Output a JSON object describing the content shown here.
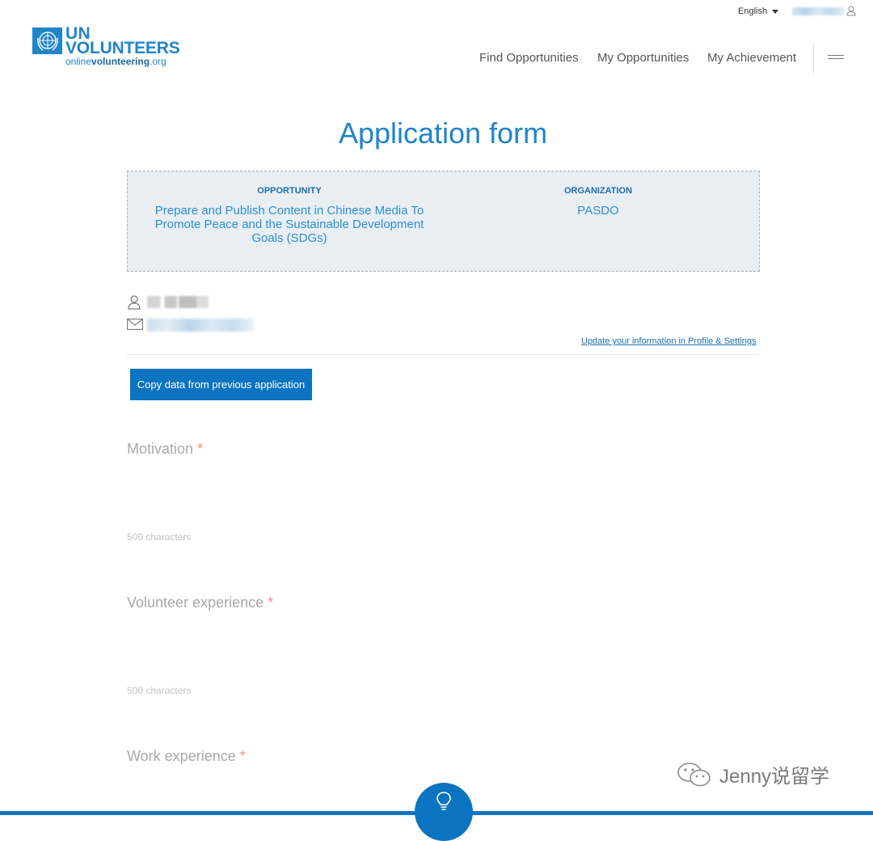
{
  "header": {
    "language": "English",
    "logo": {
      "line1": "UN",
      "line2": "VOLUNTEERS",
      "url_prefix": "online",
      "url_main": "volunteering",
      "url_suffix": ".org"
    },
    "nav": [
      {
        "label": "Find Opportunities"
      },
      {
        "label": "My Opportunities"
      },
      {
        "label": "My Achievement"
      }
    ],
    "menu_icon": "hamburger-icon"
  },
  "page": {
    "title": "Application form",
    "opportunity": {
      "heading": "OPPORTUNITY",
      "line1": "Prepare and Publish Content in Chinese Media To",
      "line2": "Promote Peace and the Sustainable Development",
      "line3": "Goals (SDGs)"
    },
    "organization": {
      "heading": "ORGANIZATION",
      "value": "PASDO"
    },
    "profile": {
      "person_icon": "person-icon",
      "mail_icon": "mail-icon",
      "update_link": "Update your information in Profile & Settings"
    },
    "copy_button": "Copy data from previous application",
    "fields": [
      {
        "label": "Motivation",
        "required": "*",
        "hint": "500 characters"
      },
      {
        "label": "Volunteer experience",
        "required": "*",
        "hint": "500 characters"
      },
      {
        "label": "Work experience",
        "required": "*"
      }
    ]
  },
  "watermark": "Jenny说留学",
  "floating_button_icon": "lightbulb-icon",
  "colors": {
    "brand": "#1f85c8",
    "button": "#0a74c0",
    "info_box": "#e9eef2",
    "required": "#f08c8c"
  }
}
